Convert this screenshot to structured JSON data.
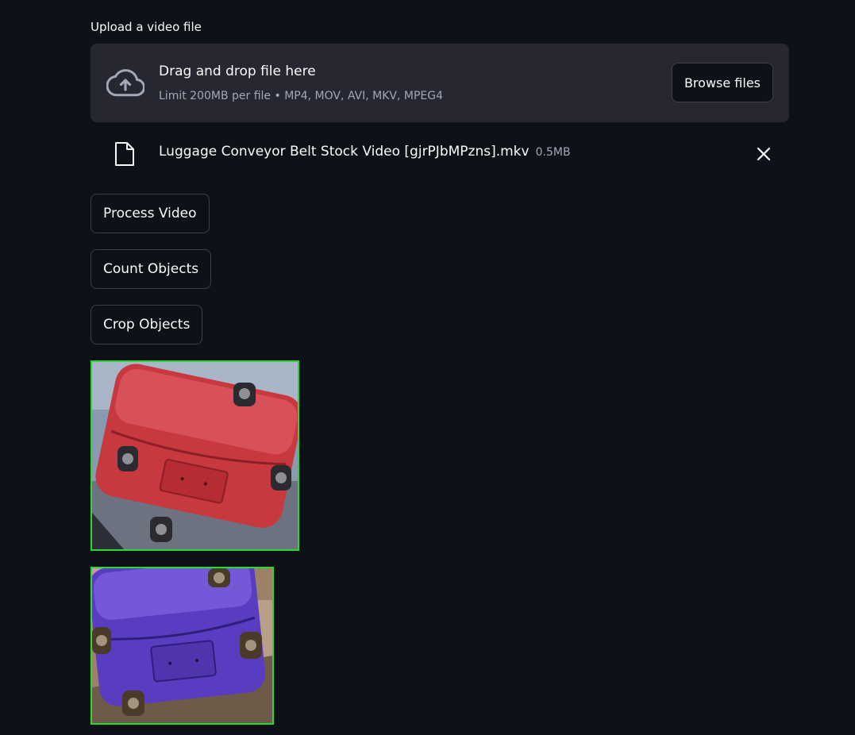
{
  "uploader": {
    "label": "Upload a video file",
    "drop_title": "Drag and drop file here",
    "drop_hint": "Limit 200MB per file • MP4, MOV, AVI, MKV, MPEG4",
    "browse_label": "Browse files",
    "icon": "cloud-upload-icon"
  },
  "uploaded_file": {
    "name": "Luggage Conveyor Belt Stock Video [gjrPJbMPzns].mkv",
    "size": "0.5MB",
    "icon": "file-icon",
    "remove_icon": "close-icon"
  },
  "actions": {
    "process_label": "Process Video",
    "count_label": "Count Objects",
    "crop_label": "Crop Objects"
  },
  "crops": [
    {
      "object": "red suitcase",
      "border_color": "#2ad930"
    },
    {
      "object": "purple suitcase",
      "border_color": "#2ad930"
    }
  ],
  "colors": {
    "background": "#0e1117",
    "surface": "#262730",
    "text": "#fafafa",
    "muted_text": "#a3a8b8",
    "crop_border": "#2ad930"
  }
}
